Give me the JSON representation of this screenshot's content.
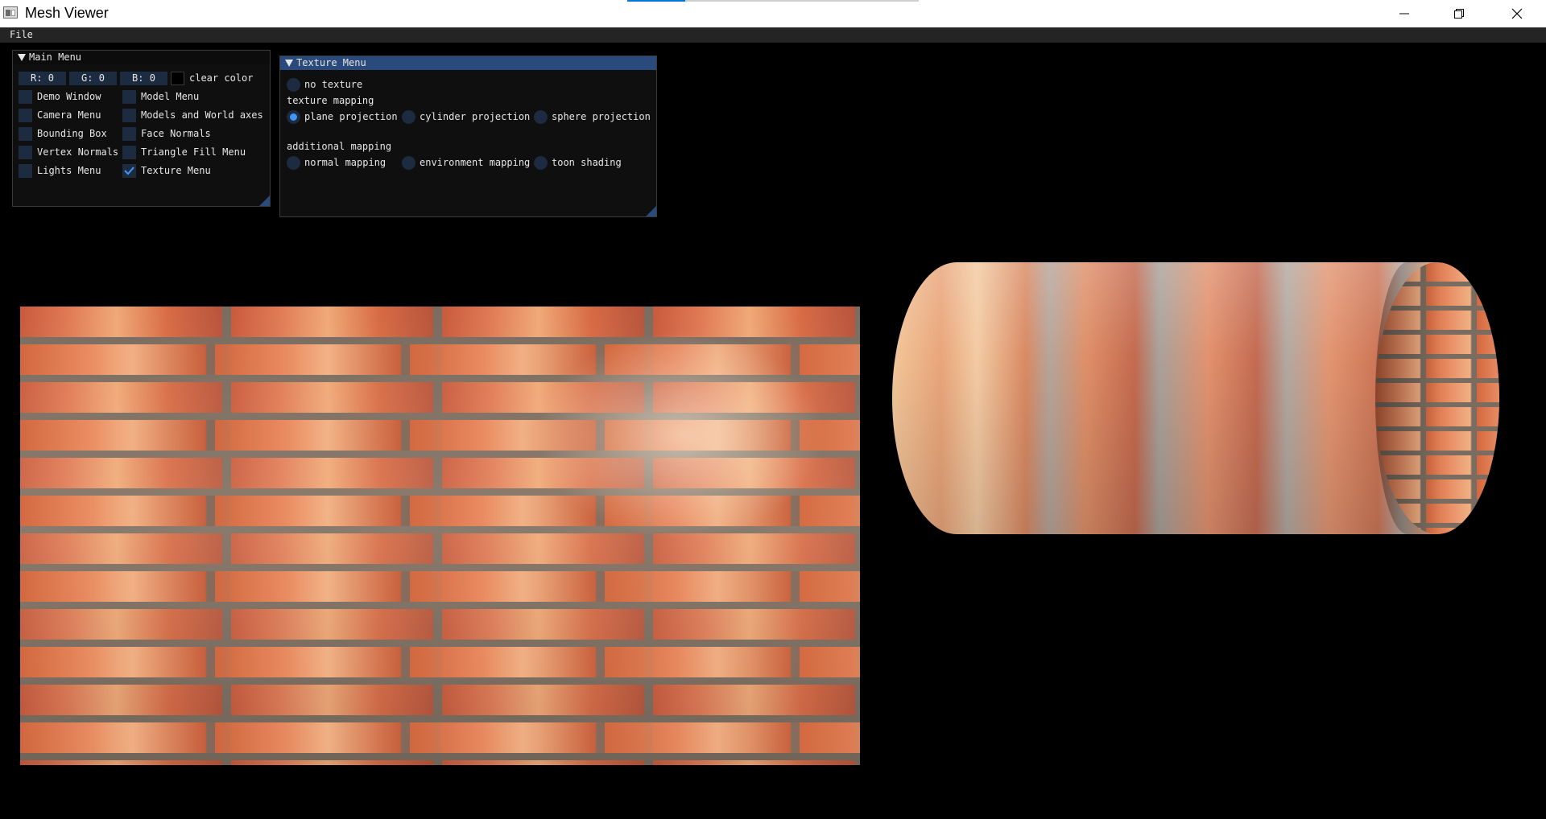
{
  "window": {
    "title": "Mesh Viewer",
    "icons": [
      "app-icon",
      "minimize-icon",
      "restore-icon",
      "close-icon"
    ]
  },
  "menubar": {
    "file": "File"
  },
  "main_menu": {
    "title": "Main Menu",
    "color": {
      "r": "R:  0",
      "g": "G:  0",
      "b": "B:  0",
      "clear_label": "clear color"
    },
    "left_items": [
      {
        "label": "Demo Window",
        "checked": false
      },
      {
        "label": "Camera Menu",
        "checked": false
      },
      {
        "label": "Bounding Box",
        "checked": false
      },
      {
        "label": "Vertex Normals",
        "checked": false
      },
      {
        "label": "Lights Menu",
        "checked": false
      }
    ],
    "right_items": [
      {
        "label": "Model Menu",
        "checked": false
      },
      {
        "label": "Models and World axes",
        "checked": false
      },
      {
        "label": "Face Normals",
        "checked": false
      },
      {
        "label": "Triangle Fill Menu",
        "checked": false
      },
      {
        "label": "Texture Menu",
        "checked": true
      }
    ]
  },
  "texture_menu": {
    "title": "Texture Menu",
    "no_texture": "no texture",
    "texture_mapping_label": "texture mapping",
    "mapping_options": [
      {
        "label": "plane projection",
        "selected": true
      },
      {
        "label": "cylinder projection",
        "selected": false
      },
      {
        "label": "sphere projection",
        "selected": false
      }
    ],
    "additional_mapping_label": "additional mapping",
    "additional_options": [
      {
        "label": "normal mapping",
        "selected": false
      },
      {
        "label": "environment mapping",
        "selected": false
      },
      {
        "label": "toon shading",
        "selected": false
      }
    ]
  },
  "viewport": {
    "objects": [
      "brick-textured-plane",
      "brick-textured-cylinder"
    ],
    "colors": {
      "background": "#000000",
      "accent": "#4296fa",
      "title_active": "#294a7a"
    }
  }
}
